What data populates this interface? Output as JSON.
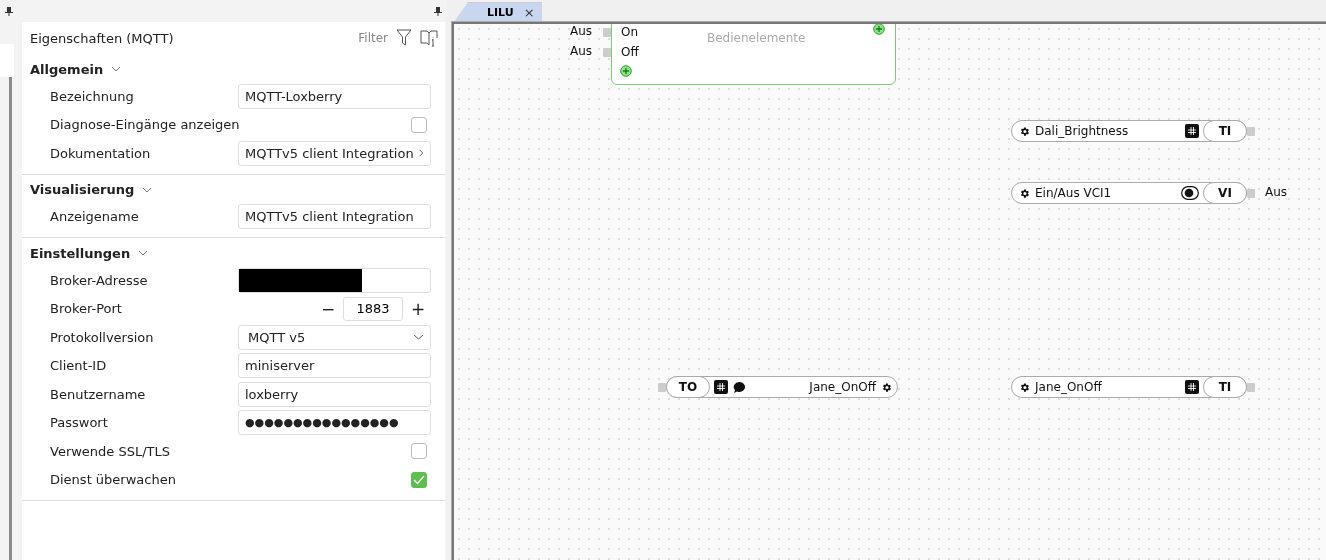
{
  "panel": {
    "title": "Eigenschaften (MQTT)",
    "filter_label": "Filter",
    "sections": [
      {
        "title": "Allgemein",
        "expanded": true,
        "rows": [
          {
            "kind": "text",
            "label": "Bezeichnung",
            "value": "MQTT-Loxberry"
          },
          {
            "kind": "checkbox",
            "label": "Diagnose-Eingänge anzeigen",
            "checked": false
          },
          {
            "kind": "link",
            "label": "Dokumentation",
            "value": "MQTTv5 client Integration"
          }
        ]
      },
      {
        "title": "Visualisierung",
        "expanded": true,
        "rows": [
          {
            "kind": "text",
            "label": "Anzeigename",
            "value": "MQTTv5 client Integration"
          }
        ]
      },
      {
        "title": "Einstellungen",
        "expanded": true,
        "rows": [
          {
            "kind": "redacted",
            "label": "Broker-Adresse"
          },
          {
            "kind": "stepper",
            "label": "Broker-Port",
            "value": "1883",
            "minus": "−",
            "plus": "+"
          },
          {
            "kind": "select",
            "label": "Protokollversion",
            "value": "MQTT v5"
          },
          {
            "kind": "text",
            "label": "Client-ID",
            "value": "miniserver"
          },
          {
            "kind": "text",
            "label": "Benutzername",
            "value": "loxberry"
          },
          {
            "kind": "password",
            "label": "Passwort",
            "value": "●●●●●●●●●●●●●●●●"
          },
          {
            "kind": "checkbox",
            "label": "Verwende SSL/TLS",
            "checked": false
          },
          {
            "kind": "checkbox",
            "label": "Dienst überwachen",
            "checked": true
          }
        ]
      }
    ]
  },
  "tabs": [
    {
      "label": "LILU",
      "close": "×",
      "selected": true
    }
  ],
  "canvas": {
    "block": {
      "title": "Bedienelemente",
      "inputs": [
        {
          "reading": "Aus",
          "label": "On"
        },
        {
          "reading": "Aus",
          "label": "Off"
        }
      ]
    },
    "nodes": [
      {
        "kind": "input",
        "label": "Dali_Brightness",
        "badges": [
          {
            "kind": "hash"
          }
        ],
        "code": "TI"
      },
      {
        "kind": "input",
        "label": "Ein/Aus VCI1",
        "badges": [
          {
            "kind": "toggle"
          }
        ],
        "code": "VI",
        "reading": "Aus"
      },
      {
        "kind": "output",
        "label": "Jane_OnOff",
        "badges": [
          {
            "kind": "hash"
          },
          {
            "kind": "comment"
          }
        ],
        "code": "TO"
      },
      {
        "kind": "input",
        "label": "Jane_OnOff",
        "badges": [
          {
            "kind": "hash"
          }
        ],
        "code": "TI"
      }
    ]
  }
}
